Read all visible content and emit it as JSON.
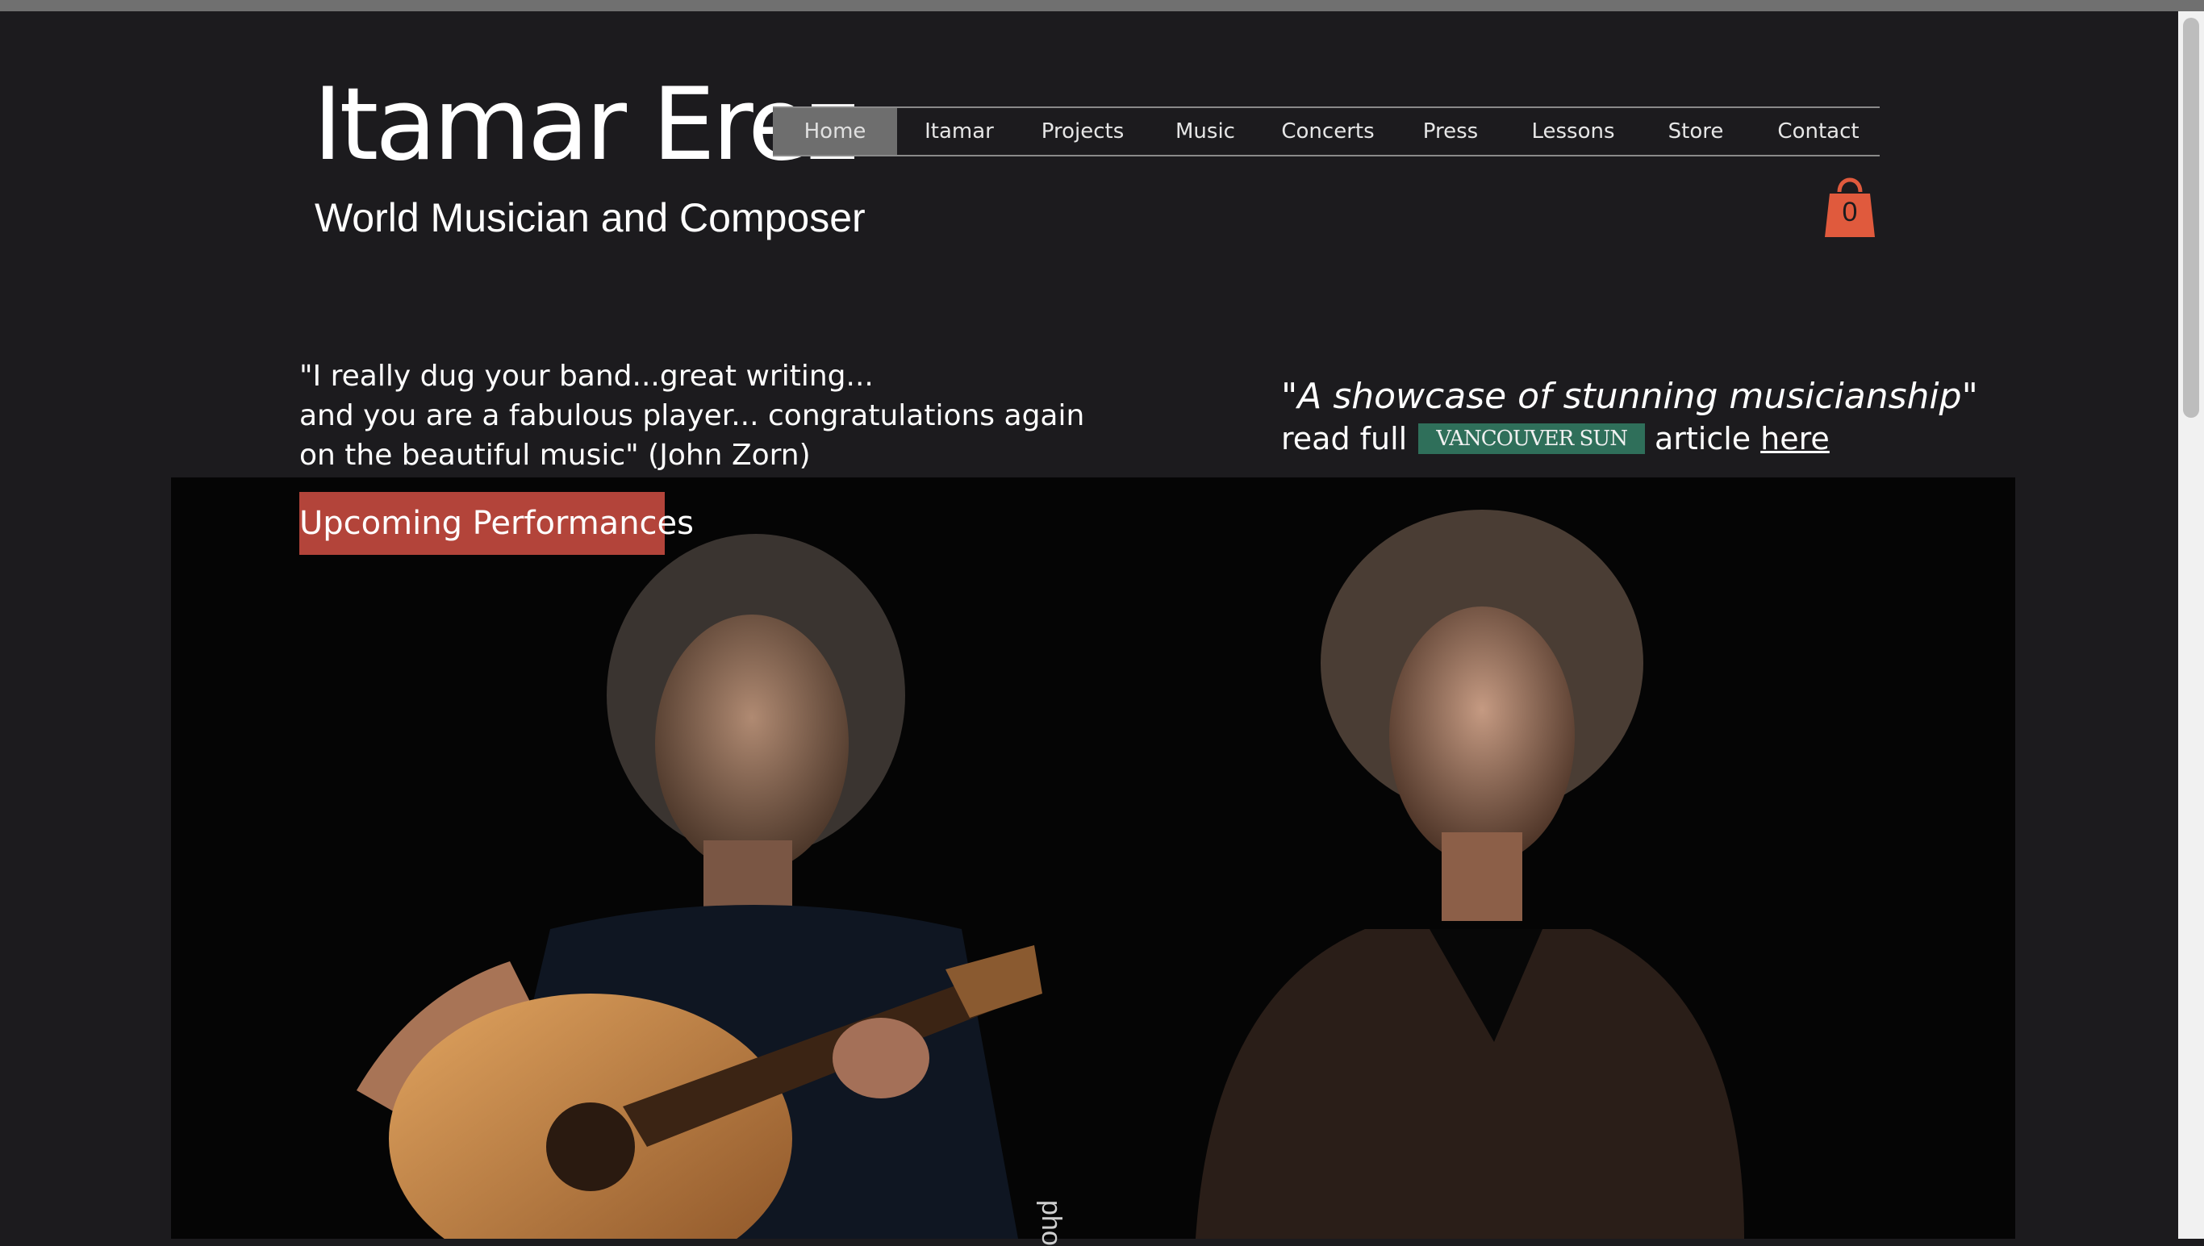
{
  "header": {
    "title": "Itamar Erez",
    "subtitle": "World Musician and Composer"
  },
  "nav": {
    "items": [
      {
        "label": "Home",
        "active": true
      },
      {
        "label": "Itamar",
        "active": false
      },
      {
        "label": "Projects",
        "active": false
      },
      {
        "label": "Music",
        "active": false
      },
      {
        "label": "Concerts",
        "active": false
      },
      {
        "label": "Press",
        "active": false
      },
      {
        "label": "Lessons",
        "active": false
      },
      {
        "label": "Store",
        "active": false
      },
      {
        "label": "Contact",
        "active": false
      }
    ]
  },
  "cart": {
    "count": "0",
    "icon": "shopping-bag-icon",
    "color": "#e05a3d"
  },
  "quotes": {
    "left": {
      "line1": "\"I really dug your band...great writing...",
      "line2": "and you are a fabulous player... congratulations again",
      "line3": "on the beautiful music\" (John Zorn)"
    },
    "right": {
      "quote": "\"A showcase of stunning musicianship\"",
      "prefix": "read full",
      "source_logo": "VANCOUVER SUN",
      "suffix": "article",
      "link": "here"
    }
  },
  "hero": {
    "button_label": "Upcoming Performances",
    "button_color": "#b3443a",
    "photo_credit": "pho"
  },
  "colors": {
    "background": "#1c1b1e",
    "nav_active": "#6e6e6e",
    "badge": "#2f6f5a"
  }
}
